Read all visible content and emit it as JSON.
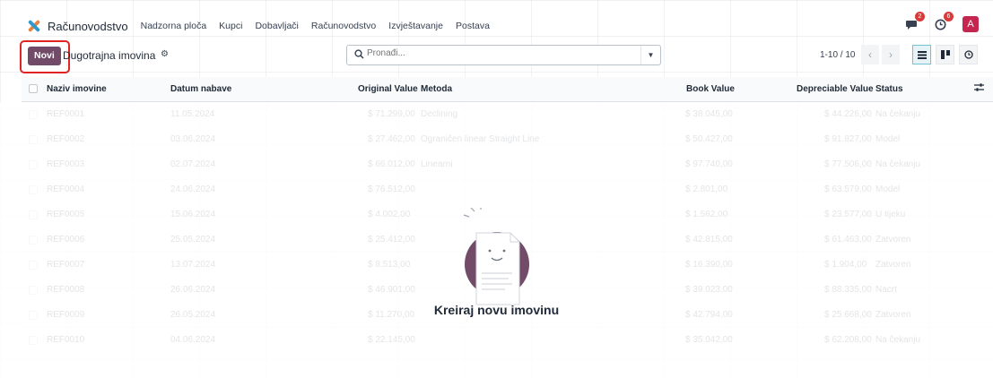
{
  "navbar": {
    "app_name": "Računovodstvo",
    "menu": [
      "Nadzorna ploča",
      "Kupci",
      "Dobavljači",
      "Računovodstvo",
      "Izvještavanje",
      "Postava"
    ],
    "messages_count": "2",
    "activities_count": "6",
    "user_initial": "A"
  },
  "control": {
    "new_label": "Novi",
    "breadcrumb": "Dugotrajna imovina",
    "search_placeholder": "Pronađi...",
    "pager": "1-10 / 10"
  },
  "table": {
    "headers": [
      "Naziv imovine",
      "Datum nabave",
      "Original Value",
      "Metoda",
      "Book Value",
      "Depreciable Value",
      "Status"
    ],
    "rows": [
      {
        "name": "REF0001",
        "date": "11.05.2024",
        "original": "$ 71.299,00",
        "method": "Declining",
        "book": "$ 38.045,00",
        "depreciable": "$ 44.226,00",
        "status": "Na čekanju"
      },
      {
        "name": "REF0002",
        "date": "03.06.2024",
        "original": "$ 27.462,00",
        "method": "Ograničen linear Straight Line",
        "book": "$ 50.427,00",
        "depreciable": "$ 91.827,00",
        "status": "Model"
      },
      {
        "name": "REF0003",
        "date": "02.07.2024",
        "original": "$ 66.012,00",
        "method": "Linearni",
        "book": "$ 97.740,00",
        "depreciable": "$ 77.506,00",
        "status": "Na čekanju"
      },
      {
        "name": "REF0004",
        "date": "24.06.2024",
        "original": "$ 76.512,00",
        "method": "",
        "book": "$ 2.801,00",
        "depreciable": "$ 63.579,00",
        "status": "Model"
      },
      {
        "name": "REF0005",
        "date": "15.06.2024",
        "original": "$ 4.002,00",
        "method": "",
        "book": "$ 1.562,00",
        "depreciable": "$ 23.577,00",
        "status": "U tijeku"
      },
      {
        "name": "REF0006",
        "date": "25.05.2024",
        "original": "$ 25.412,00",
        "method": "",
        "book": "$ 42.815,00",
        "depreciable": "$ 61.463,00",
        "status": "Zatvoren"
      },
      {
        "name": "REF0007",
        "date": "13.07.2024",
        "original": "$ 8.513,00",
        "method": "",
        "book": "$ 16.390,00",
        "depreciable": "$ 1.904,00",
        "status": "Zatvoren"
      },
      {
        "name": "REF0008",
        "date": "26.06.2024",
        "original": "$ 46.901,00",
        "method": "",
        "book": "$ 39.023,00",
        "depreciable": "$ 88.335,00",
        "status": "Nacrt"
      },
      {
        "name": "REF0009",
        "date": "26.05.2024",
        "original": "$ 11.270,00",
        "method": "",
        "book": "$ 42.794,00",
        "depreciable": "$ 25.668,00",
        "status": "Zatvoren"
      },
      {
        "name": "REF0010",
        "date": "04.06.2024",
        "original": "$ 22.145,00",
        "method": "",
        "book": "$ 35.042,00",
        "depreciable": "$ 62.208,00",
        "status": "Na čekanju"
      }
    ]
  },
  "helper": {
    "title": "Kreiraj novu imovinu"
  },
  "colors": {
    "primary": "#714b67",
    "highlight": "#e02424",
    "active_view": "#71c3d3"
  }
}
